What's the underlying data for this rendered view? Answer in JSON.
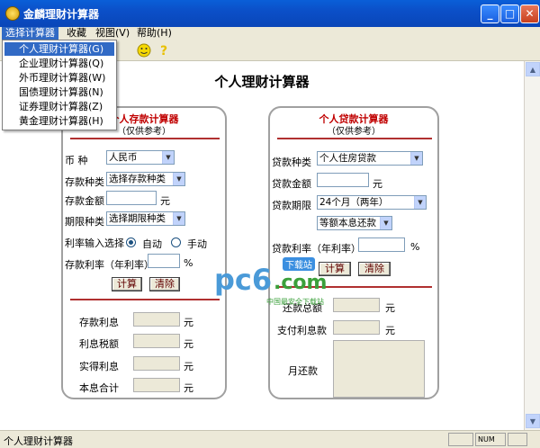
{
  "window": {
    "title": "金麟理财计算器",
    "minimize": "_",
    "maximize": "□",
    "close": "✕"
  },
  "menubar": [
    {
      "label": "选择计算器"
    },
    {
      "label": "收藏"
    },
    {
      "label": "视图(V)"
    },
    {
      "label": "帮助(H)"
    }
  ],
  "dropdown": [
    {
      "label": "个人理财计算器(G)"
    },
    {
      "label": "企业理财计算器(Q)"
    },
    {
      "label": "外币理财计算器(W)"
    },
    {
      "label": "国债理财计算器(N)"
    },
    {
      "label": "证券理财计算器(Z)"
    },
    {
      "label": "黄金理财计算器(H)"
    }
  ],
  "main_title": "个人理财计算器",
  "deposit": {
    "title": "个人存款计算器",
    "subtitle": "（仅供参考）",
    "currency_label": "币    种",
    "currency_value": "人民币",
    "type_label": "存款种类",
    "type_value": "选择存款种类",
    "amount_label": "存款金额",
    "amount_unit": "元",
    "period_label": "期限种类",
    "period_value": "选择期限种类",
    "rate_mode_label": "利率输入选择",
    "rate_auto": "自动",
    "rate_manual": "手动",
    "rate_label": "存款利率（年利率）",
    "rate_unit": "%",
    "calc_btn": "计算",
    "clear_btn": "清除",
    "results": [
      {
        "label": "存款利息",
        "unit": "元"
      },
      {
        "label": "利息税额",
        "unit": "元"
      },
      {
        "label": "实得利息",
        "unit": "元"
      },
      {
        "label": "本息合计",
        "unit": "元"
      }
    ]
  },
  "loan": {
    "title": "个人贷款计算器",
    "subtitle": "（仅供参考）",
    "type_label": "贷款种类",
    "type_value": "个人住房贷款",
    "amount_label": "贷款金额",
    "amount_unit": "元",
    "period_label": "贷款期限",
    "period_value": "24个月（两年）",
    "method_value": "等额本息还款",
    "rate_label": "贷款利率（年利率）",
    "rate_unit": "%",
    "calc_btn": "计算",
    "clear_btn": "清除",
    "total_label": "还款总额",
    "total_unit": "元",
    "interest_label": "支付利息款",
    "interest_unit": "元",
    "monthly_label": "月还款"
  },
  "watermark": {
    "brand": "pc6",
    "domain": ".com",
    "tag": "下载站",
    "caption": "中国最安全下载站"
  },
  "status": {
    "text": "个人理财计算器",
    "num": "NUM"
  },
  "colors": {
    "accent_red": "#c00000",
    "titlebar_blue": "#0a5fd8",
    "menu_highlight": "#316ac5"
  }
}
